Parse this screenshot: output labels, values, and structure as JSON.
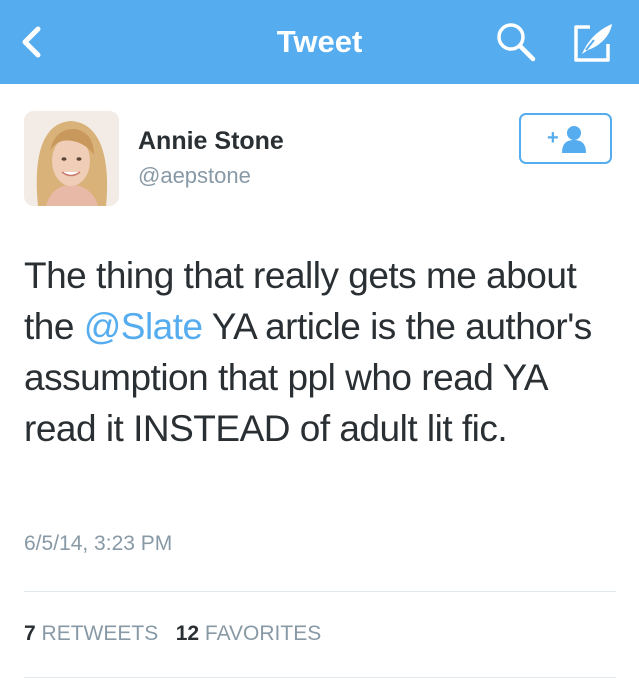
{
  "nav": {
    "title": "Tweet",
    "icons": {
      "back": "chevron-left-icon",
      "search": "search-icon",
      "compose": "compose-icon"
    }
  },
  "author": {
    "name": "Annie Stone",
    "handle": "@aepstone"
  },
  "tweet": {
    "text_before": "The thing that really gets me about the ",
    "mention": "@Slate",
    "text_after": " YA article is the author's assumption that ppl who read YA read it INSTEAD of adult lit fic.",
    "timestamp": "6/5/14, 3:23 PM"
  },
  "stats": {
    "retweets_count": "7",
    "retweets_label": "RETWEETS",
    "favorites_count": "12",
    "favorites_label": "FAVORITES"
  },
  "follow_button": {
    "label": "+",
    "icon": "add-user-icon"
  },
  "colors": {
    "brand": "#55acee",
    "text": "#292f33",
    "muted": "#8899a6",
    "divider": "#e1e8ed"
  }
}
